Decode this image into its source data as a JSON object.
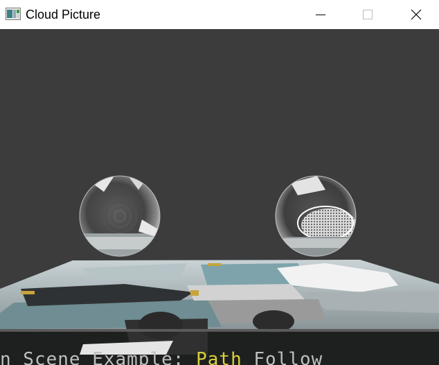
{
  "window": {
    "title": "Cloud Picture",
    "icon": "app-window-icon",
    "controls": {
      "minimize_icon": "minimize-icon",
      "maximize_icon": "maximize-icon",
      "close_icon": "close-icon"
    }
  },
  "viewport": {
    "background_color": "#3c3c3c",
    "objects": [
      "reflective-sphere-left",
      "reflective-sphere-right",
      "textured-ground-plane"
    ],
    "overlay_text": {
      "part1": "n Scene Example: ",
      "part2": "Path",
      "part3": " Follow"
    }
  },
  "colors": {
    "titlebar": "#ffffff",
    "viewport": "#3c3c3c",
    "overlay_white": "#bfbfbf",
    "overlay_yellow": "#d9d13a"
  }
}
